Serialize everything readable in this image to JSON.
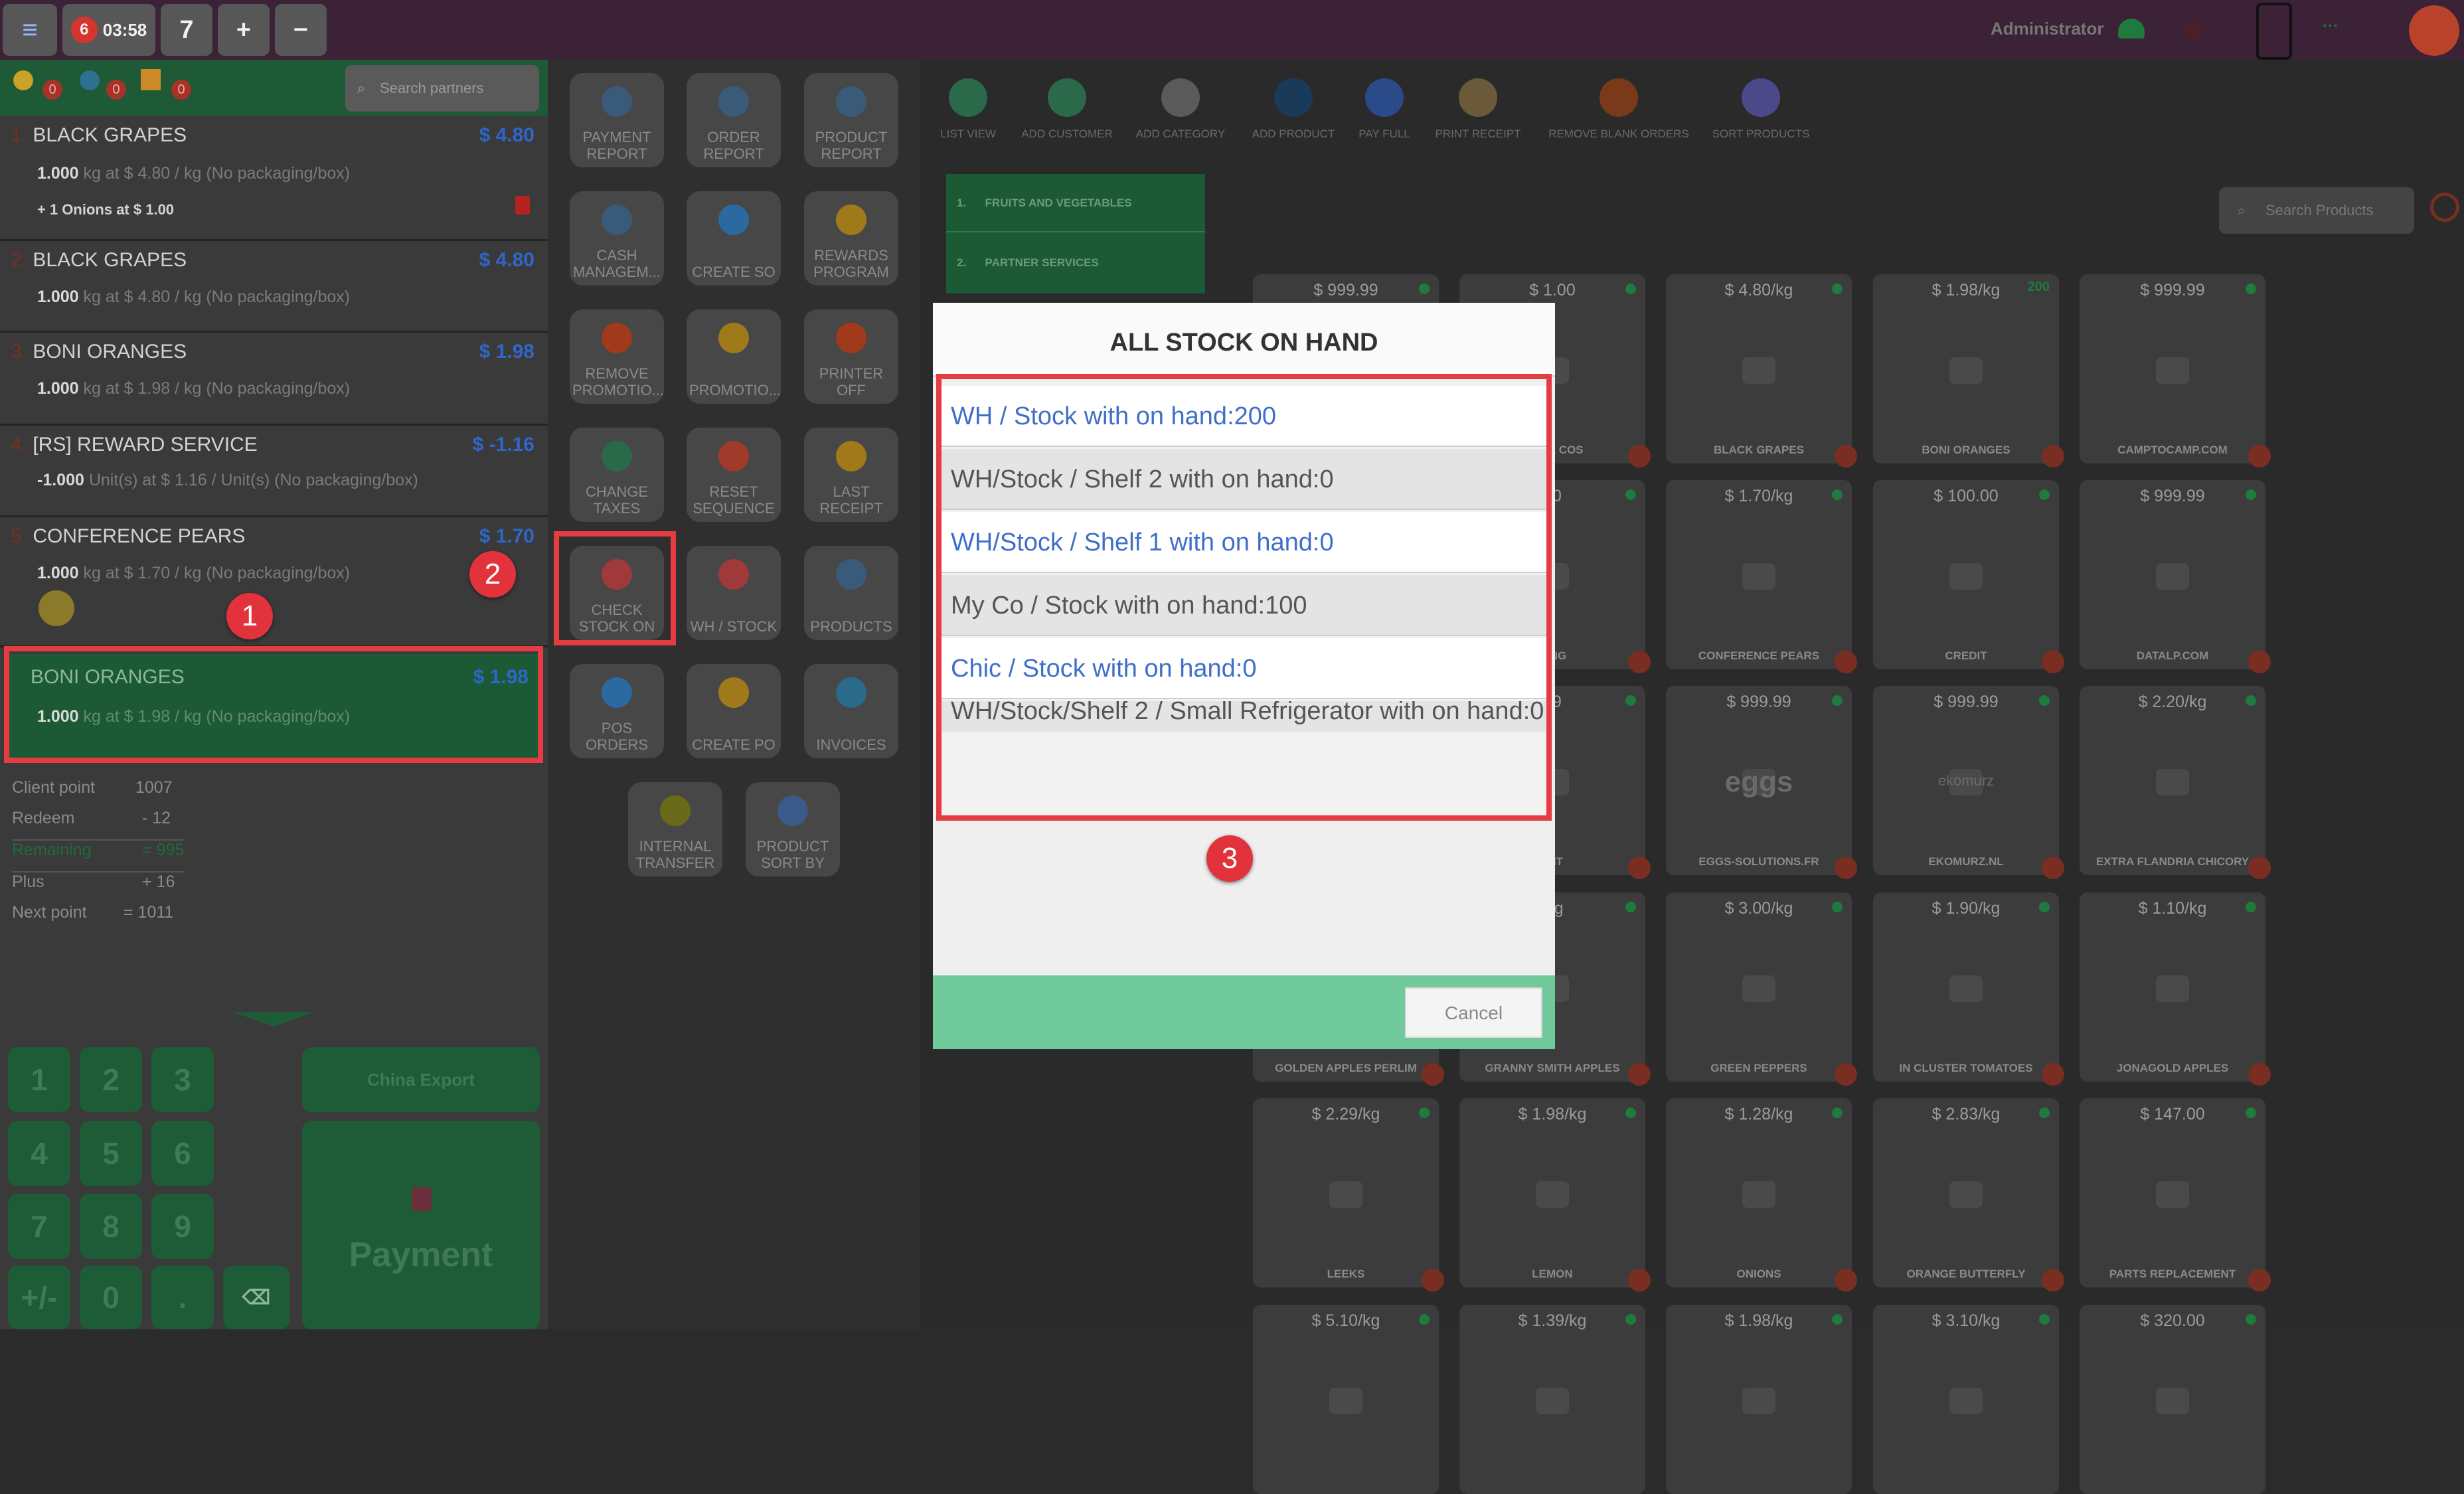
{
  "topbar": {
    "badge_count": "6",
    "time": "03:58",
    "order_number": "7",
    "plus": "+",
    "minus": "−",
    "user": "Administrator"
  },
  "order_header": {
    "counts": [
      "0",
      "0",
      "0"
    ],
    "search_placeholder": "Search partners"
  },
  "order_lines": [
    {
      "num": "1.",
      "name": "BLACK GRAPES",
      "price": "$ 4.80",
      "qty": "1.000",
      "detail": " kg at $ 4.80 / kg (No packaging/box)",
      "extra": "+ 1 Onions at $ 1.00"
    },
    {
      "num": "2.",
      "name": "BLACK GRAPES",
      "price": "$ 4.80",
      "qty": "1.000",
      "detail": " kg at $ 4.80 / kg (No packaging/box)"
    },
    {
      "num": "3.",
      "name": "BONI ORANGES",
      "price": "$ 1.98",
      "qty": "1.000",
      "detail": " kg at $ 1.98 / kg (No packaging/box)"
    },
    {
      "num": "4.",
      "name": "[RS] REWARD SERVICE",
      "price": "$ -1.16",
      "qty": "-1.000",
      "detail": " Unit(s) at $ 1.16 / Unit(s) (No packaging/box)"
    },
    {
      "num": "5.",
      "name": "CONFERENCE PEARS",
      "price": "$ 1.70",
      "qty": "1.000",
      "detail": " kg at $ 1.70 / kg (No packaging/box)"
    },
    {
      "num": "",
      "name": "BONI ORANGES",
      "price": "$ 1.98",
      "qty": "1.000",
      "detail": " kg at $ 1.98 / kg (No packaging/box)"
    }
  ],
  "points": {
    "client_label": "Client point",
    "client_value": "1007",
    "redeem_label": "Redeem",
    "redeem_value": "- 12",
    "remaining_label": "Remaining",
    "remaining_value": "= 995",
    "plus_label": "Plus",
    "plus_value": "+ 16",
    "next_label": "Next point",
    "next_value": "= 1011"
  },
  "numpad": [
    "1",
    "2",
    "3",
    "4",
    "5",
    "6",
    "7",
    "8",
    "9",
    "+/-",
    "0",
    "."
  ],
  "china_export": "China Export",
  "payment": "Payment",
  "tools": [
    [
      "PAYMENT",
      "REPORT"
    ],
    [
      "ORDER",
      "REPORT"
    ],
    [
      "PRODUCT",
      "REPORT"
    ],
    [
      "CASH",
      "MANAGEM..."
    ],
    [
      "CREATE SO",
      ""
    ],
    [
      "REWARDS",
      "PROGRAM"
    ],
    [
      "REMOVE",
      "PROMOTIO..."
    ],
    [
      "PROMOTIO...",
      ""
    ],
    [
      "PRINTER",
      "OFF"
    ],
    [
      "CHANGE",
      "TAXES"
    ],
    [
      "RESET",
      "SEQUENCE"
    ],
    [
      "LAST",
      "RECEIPT"
    ],
    [
      "CHECK",
      "STOCK ON"
    ],
    [
      "WH / STOCK",
      ""
    ],
    [
      "PRODUCTS",
      ""
    ],
    [
      "POS",
      "ORDERS"
    ],
    [
      "CREATE PO",
      ""
    ],
    [
      "INVOICES",
      ""
    ],
    [
      "INTERNAL",
      "TRANSFER"
    ],
    [
      "PRODUCT",
      "SORT BY"
    ]
  ],
  "category_actions": [
    "LIST VIEW",
    "ADD CUSTOMER",
    "ADD CATEGORY",
    "ADD PRODUCT",
    "PAY FULL",
    "PRINT RECEIPT",
    "REMOVE BLANK ORDERS",
    "SORT PRODUCTS"
  ],
  "categories": [
    {
      "num": "1.",
      "name": "FRUITS AND VEGETABLES"
    },
    {
      "num": "2.",
      "name": "PARTNER SERVICES"
    }
  ],
  "search_products_placeholder": "Search Products",
  "products": [
    {
      "price": "$ 999.99",
      "name": ""
    },
    {
      "price": "$ 1.00",
      "name": "RVICE COS"
    },
    {
      "price": "$ 4.80/kg",
      "name": "BLACK GRAPES"
    },
    {
      "price": "$ 1.98/kg",
      "name": "BONI ORANGES",
      "qty": "200"
    },
    {
      "price": "$ 999.99",
      "name": "CAMPTOCAMP.COM"
    },
    {
      "price": "",
      "name": ""
    },
    {
      "price": "50",
      "name": "NING"
    },
    {
      "price": "$ 1.70/kg",
      "name": "CONFERENCE PEARS"
    },
    {
      "price": "$ 100.00",
      "name": "CREDIT"
    },
    {
      "price": "$ 999.99",
      "name": "DATALP.COM"
    },
    {
      "price": "",
      "name": ""
    },
    {
      "price": "99",
      "name": "E-IT"
    },
    {
      "price": "$ 999.99",
      "name": "EGGS-SOLUTIONS.FR"
    },
    {
      "price": "$ 999.99",
      "name": "EKOMURZ.NL"
    },
    {
      "price": "$ 2.20/kg",
      "name": "EXTRA FLANDRIA CHICORY"
    },
    {
      "price": "",
      "name": "GOLDEN APPLES PERLIM"
    },
    {
      "price": "/kg",
      "name": "GRANNY SMITH APPLES"
    },
    {
      "price": "$ 3.00/kg",
      "name": "GREEN PEPPERS"
    },
    {
      "price": "$ 1.90/kg",
      "name": "IN CLUSTER TOMATOES"
    },
    {
      "price": "$ 1.10/kg",
      "name": "JONAGOLD APPLES"
    },
    {
      "price": "$ 2.29/kg",
      "name": "LEEKS"
    },
    {
      "price": "$ 1.98/kg",
      "name": "LEMON"
    },
    {
      "price": "$ 1.28/kg",
      "name": "ONIONS"
    },
    {
      "price": "$ 2.83/kg",
      "name": "ORANGE BUTTERFLY"
    },
    {
      "price": "$ 147.00",
      "name": "PARTS REPLACEMENT"
    },
    {
      "price": "$ 5.10/kg",
      "name": ""
    },
    {
      "price": "$ 1.39/kg",
      "name": ""
    },
    {
      "price": "$ 1.98/kg",
      "name": ""
    },
    {
      "price": "$ 3.10/kg",
      "name": ""
    },
    {
      "price": "$ 320.00",
      "name": ""
    }
  ],
  "eggs_logo": "eggs",
  "ekomurz_logo": "ekomurz",
  "modal": {
    "title": "ALL STOCK ON HAND",
    "rows": [
      {
        "text": "WH / Stock with on hand:200",
        "color": "#3f6fc9"
      },
      {
        "text": "WH/Stock / Shelf 2 with on hand:0",
        "color": "#555555"
      },
      {
        "text": "WH/Stock / Shelf 1 with on hand:0",
        "color": "#3f6fc9"
      },
      {
        "text": "My Co / Stock with on hand:100",
        "color": "#555555"
      },
      {
        "text": "Chic / Stock with on hand:0",
        "color": "#3f6fc9"
      },
      {
        "text": "WH/Stock/Shelf 2 / Small Refrigerator with on hand:0",
        "color": "#555555"
      }
    ],
    "cancel": "Cancel"
  },
  "annotations": [
    "1",
    "2",
    "3"
  ],
  "colors": {
    "highlight": "#e53b43",
    "accent_green": "#6fc99a",
    "link_blue": "#3f6fc9"
  }
}
